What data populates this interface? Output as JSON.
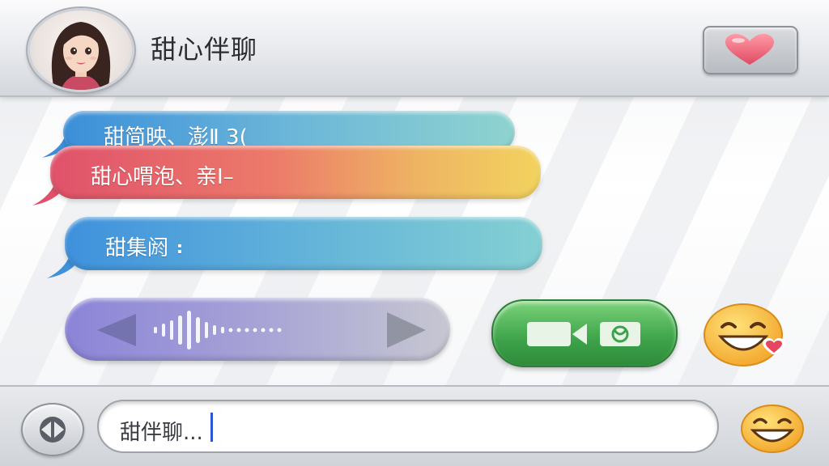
{
  "header": {
    "title": "甜心伴聊",
    "avatar_icon": "girl-avatar",
    "favorite_icon": "heart-icon"
  },
  "messages": [
    {
      "text": "甜简映、澎Ⅱ 3(",
      "color": "#4f9fd9"
    },
    {
      "text": "甜心喟泡、亲Ⅰ–",
      "color": "#e6606a"
    },
    {
      "text": "甜集阏 ⠆",
      "color": "#4aa5db"
    }
  ],
  "voice_message": {
    "icon": "waveform-icon"
  },
  "video_call": {
    "icons": [
      "video-camera-icon",
      "phone-icon"
    ],
    "color": "#3da34a"
  },
  "emoji_reaction": {
    "icon": "grinning-face-heart-icon"
  },
  "input_bar": {
    "placeholder": "甜伴聊...",
    "left_button_icon": "play-toggle-icon",
    "emoji_button_icon": "grinning-face-icon"
  }
}
